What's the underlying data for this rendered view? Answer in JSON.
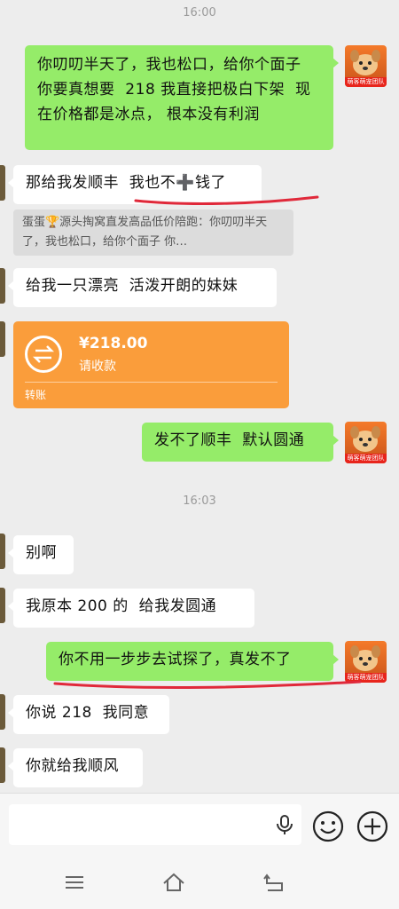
{
  "timestamps": [
    "16:00",
    "16:03"
  ],
  "messages": {
    "m1": "你叨叨半天了，我也松口，给你个面子  你要真想要  218 我直接把极白下架  现在价格都是冰点， 根本没有利润",
    "m2": "那给我发顺丰  我也不➕钱了",
    "quote": "蛋蛋🏆源头掏窝直发高品低价陪跑：你叨叨半天了，我也松口，给你个面子   你…",
    "m3": "给我一只漂亮  活泼开朗的妹妹",
    "m4": "发不了顺丰  默认圆通",
    "m5": "别啊",
    "m6": "我原本 200 的  给我发圆通",
    "m7": "你不用一步步去试探了，真发不了",
    "m8": "你说 218  我同意",
    "m9": "你就给我顺风"
  },
  "transfer": {
    "amount": "¥218.00",
    "status": "请收款",
    "type": "转账"
  },
  "avatar": {
    "caption": "萌客萌宠团队"
  },
  "colors": {
    "background": "#ededed",
    "outgoing_bubble": "#95ec69",
    "incoming_bubble": "#ffffff",
    "transfer_card": "#fa9d3b",
    "annotation_underline": "#e0293a"
  },
  "icons": {
    "input_voice": "microphone-icon",
    "input_emoji": "emoji-icon",
    "input_more": "plus-circle-icon",
    "nav_menu": "menu-icon",
    "nav_home": "home-icon",
    "nav_back": "back-icon",
    "transfer": "transfer-arrows-icon"
  }
}
